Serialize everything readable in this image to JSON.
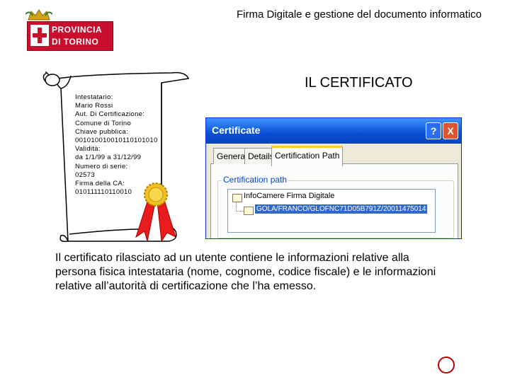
{
  "header": {
    "title": "Firma Digitale e gestione del documento informatico"
  },
  "logo": {
    "line1": "PROVINCIA",
    "line2": "DI TORINO"
  },
  "section_title": "IL CERTIFICATO",
  "certificate": {
    "lines": [
      "Intestatario:",
      "Mario Rossi",
      "Aut. Di Certificazione:",
      "Comune di Torino",
      "Chiave pubblica:",
      "001010010010110101010",
      "Validità:",
      "da 1/1/99  a 31/12/99",
      "Numero di serie:",
      "02573",
      "Firma della CA:",
      "010111110110010"
    ]
  },
  "dialog": {
    "title": "Certificate",
    "help_label": "?",
    "close_label": "X",
    "tabs": [
      "General",
      "Details",
      "Certification Path"
    ],
    "group_label": "Certification path",
    "tree": {
      "root": "InfoCamere Firma Digitale",
      "child": "GOLA/FRANCO/GLOFNC71D05B791Z/20011475014"
    }
  },
  "description": "Il certificato rilasciato ad un utente contiene le informazioni relative alla persona fisica intestataria (nome, cognome, codice fiscale) e le informazioni relative all’autorità di certificazione che l’ha emesso.",
  "colors": {
    "brand_red": "#c8102e",
    "titlebar_blue": "#0a4fd6",
    "ribbon_red": "#e81c1c",
    "seal_gold": "#f0c020"
  }
}
